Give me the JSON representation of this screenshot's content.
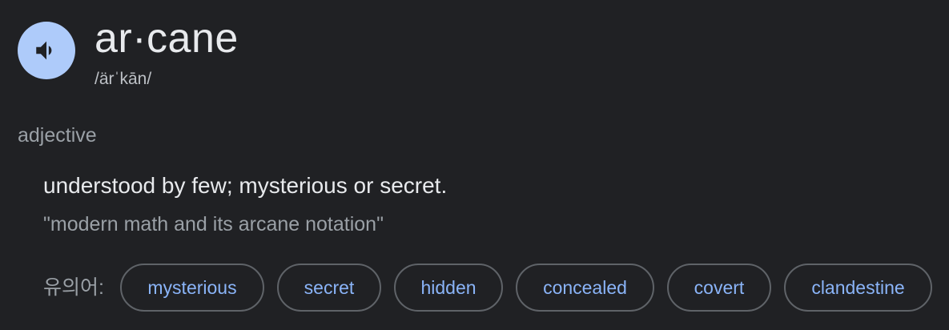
{
  "entry": {
    "word": "ar·cane",
    "phonetic": "/ärˈkān/",
    "audio_icon": "speaker-icon",
    "part_of_speech": "adjective",
    "definition": "understood by few; mysterious or secret.",
    "example": "\"modern math and its arcane notation\"",
    "synonyms_label": "유의어:",
    "synonyms": [
      "mysterious",
      "secret",
      "hidden",
      "concealed",
      "covert",
      "clandestine"
    ]
  },
  "colors": {
    "background": "#202124",
    "audio_button": "#aecbfa",
    "chip_text": "#8ab4f8",
    "chip_border": "#5f6368"
  }
}
